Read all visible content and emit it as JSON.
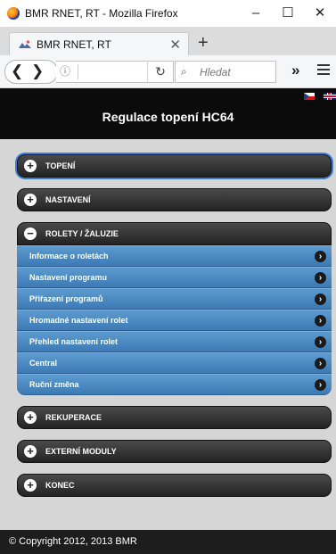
{
  "window": {
    "title": "BMR RNET, RT - Mozilla Firefox",
    "minimize": "–",
    "maximize": "☐",
    "close": "✕"
  },
  "tab": {
    "label": "BMR RNET, RT",
    "close": "✕",
    "new_tab": "+"
  },
  "nav": {
    "back": "❮",
    "forward": "❯",
    "info": "ⓘ",
    "reload": "↻",
    "search_icon": "⌕",
    "search_placeholder": "Hledat",
    "overflow": "»"
  },
  "page": {
    "header_title": "Regulace topení HC64",
    "flags": [
      "cz-flag",
      "uk-flag"
    ],
    "menu": [
      {
        "label": "TOPENÍ",
        "sign": "+"
      },
      {
        "label": "NASTAVENÍ",
        "sign": "+"
      },
      {
        "label": "ROLETY / ŽALUZIE",
        "sign": "−"
      },
      {
        "label": "REKUPERACE",
        "sign": "+"
      },
      {
        "label": "EXTERNÍ MODULY",
        "sign": "+"
      },
      {
        "label": "KONEC",
        "sign": "+"
      }
    ],
    "submenu": [
      "Informace o roletách",
      "Nastavení programu",
      "Přiřazení programů",
      "Hromadné nastavení rolet",
      "Přehled nastavení rolet",
      "Central",
      "Ruční změna"
    ],
    "arrow": "›",
    "footer": "© Copyright 2012, 2013 BMR"
  }
}
